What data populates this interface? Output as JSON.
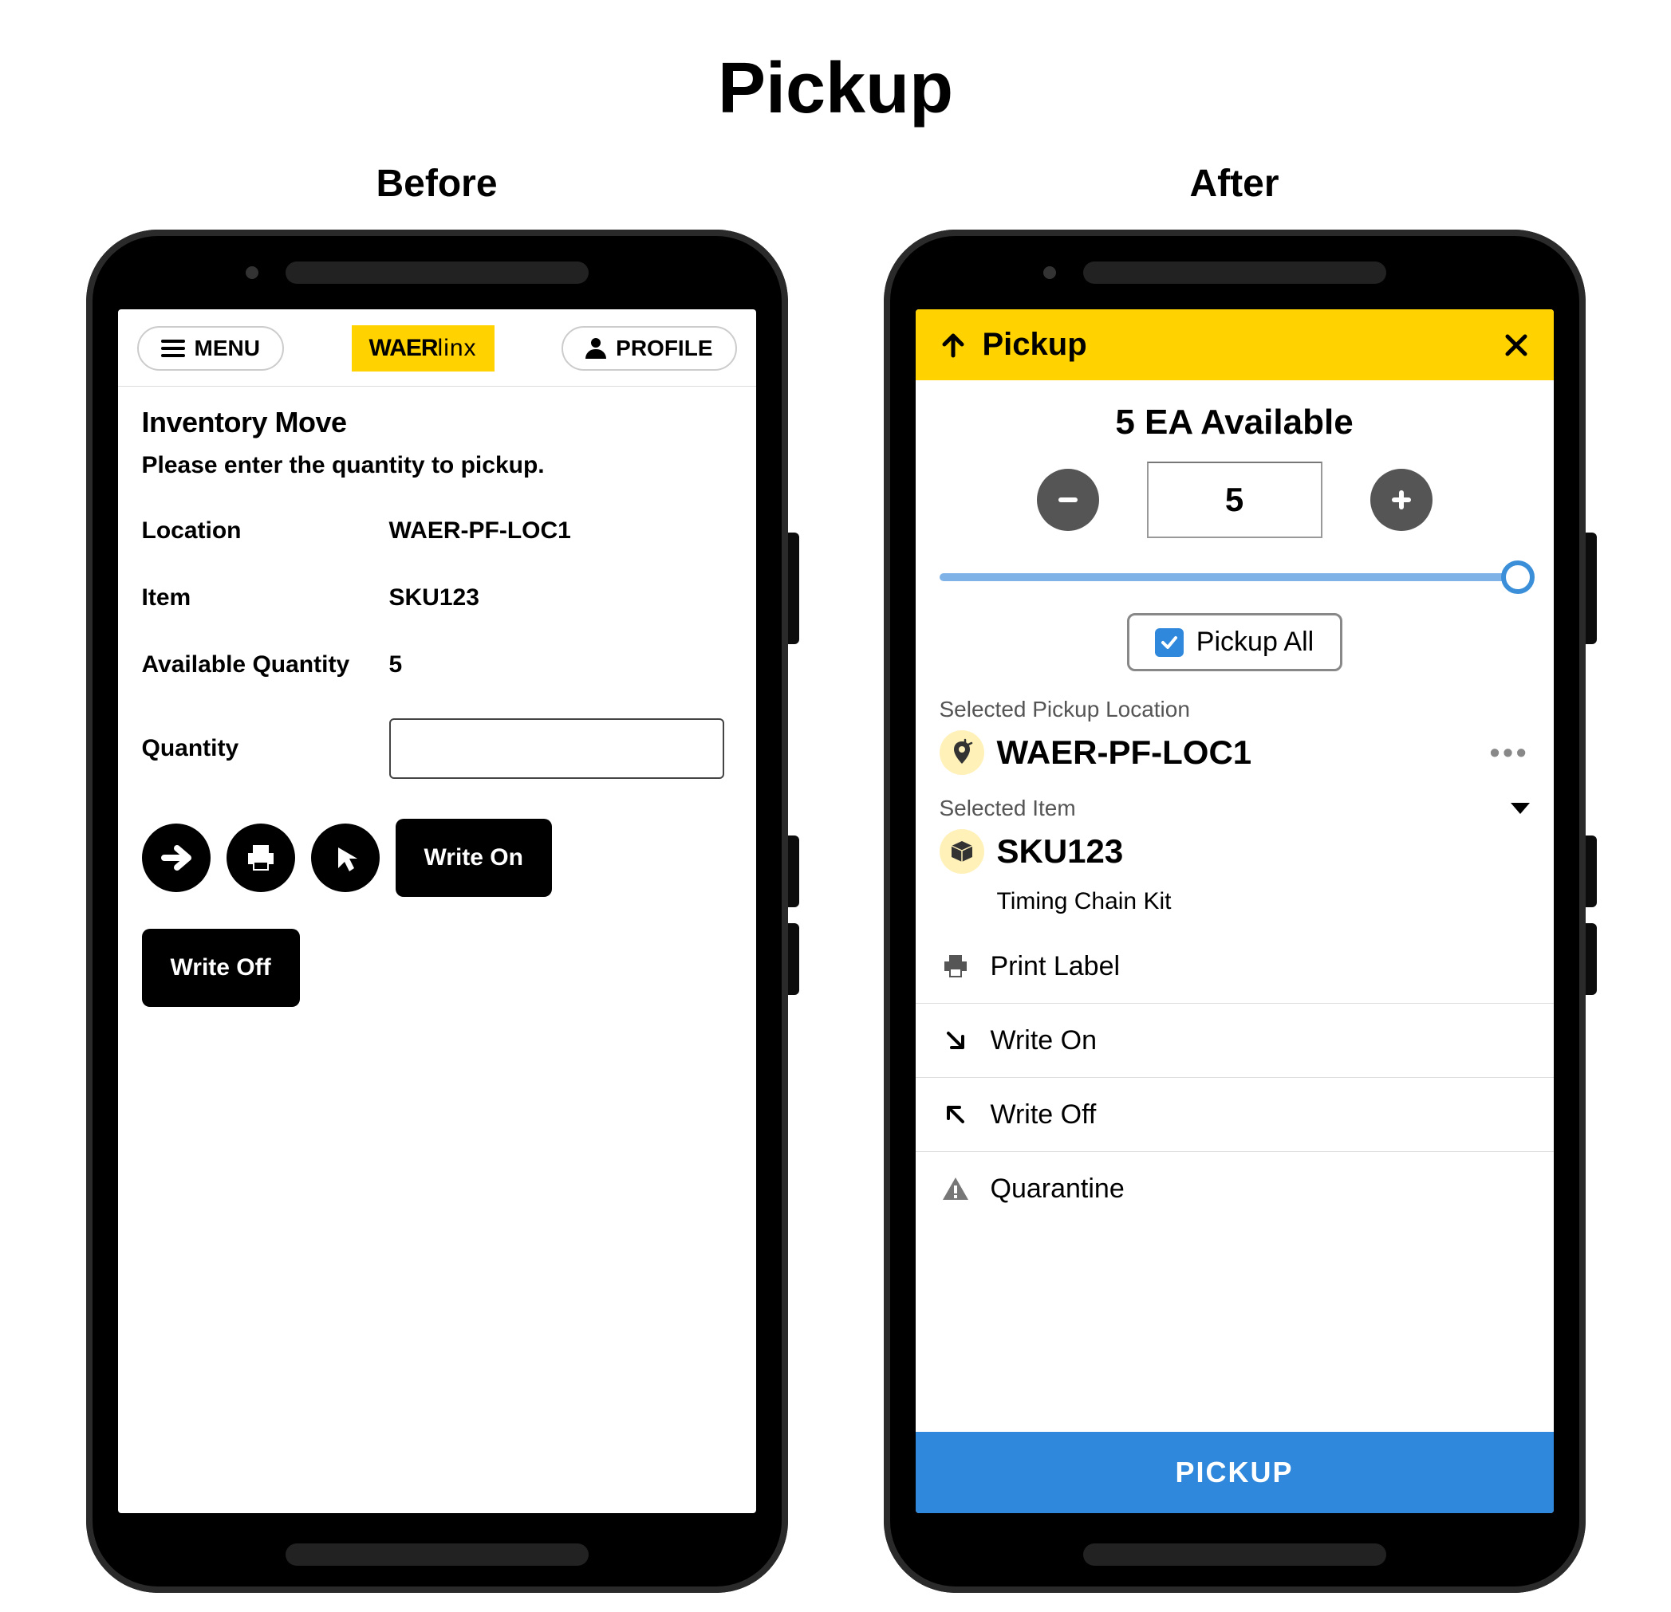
{
  "page_title": "Pickup",
  "columns": {
    "before": "Before",
    "after": "After"
  },
  "before": {
    "menu_label": "MENU",
    "brand_a": "WAER",
    "brand_b": "linx",
    "profile_label": "PROFILE",
    "screen_title": "Inventory Move",
    "instruction": "Please enter the quantity to pickup.",
    "location_label": "Location",
    "location_value": "WAER-PF-LOC1",
    "item_label": "Item",
    "item_value": "SKU123",
    "avail_label": "Available Quantity",
    "avail_value": "5",
    "qty_label": "Quantity",
    "write_on": "Write On",
    "write_off": "Write Off"
  },
  "after": {
    "header_title": "Pickup",
    "available_text": "5 EA Available",
    "quantity_value": "5",
    "pickup_all_label": "Pickup All",
    "selected_location_label": "Selected Pickup Location",
    "location_value": "WAER-PF-LOC1",
    "selected_item_label": "Selected Item",
    "item_value": "SKU123",
    "item_desc": "Timing Chain Kit",
    "actions": {
      "print": "Print Label",
      "write_on": "Write On",
      "write_off": "Write Off",
      "quarantine": "Quarantine"
    },
    "pickup_button": "PICKUP"
  },
  "colors": {
    "brand_yellow": "#ffd200",
    "accent_blue": "#2f88db"
  }
}
